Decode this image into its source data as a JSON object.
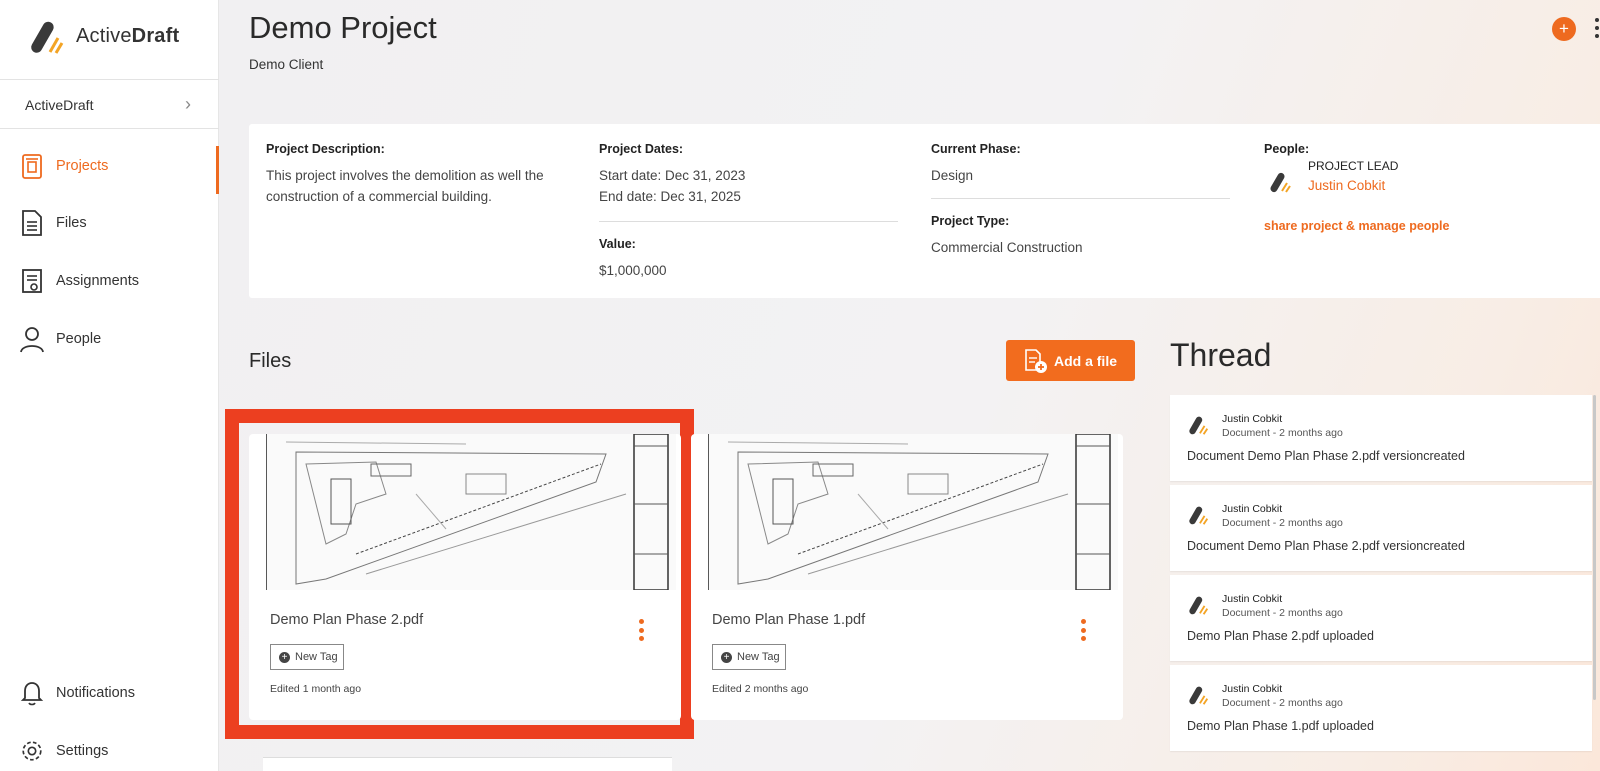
{
  "app": {
    "logo_prefix": "Active",
    "logo_bold": "Draft"
  },
  "sidebar": {
    "org": "ActiveDraft",
    "items": [
      {
        "label": "Projects",
        "icon": "projects-icon",
        "active": true
      },
      {
        "label": "Files",
        "icon": "file-icon"
      },
      {
        "label": "Assignments",
        "icon": "assignment-icon"
      },
      {
        "label": "People",
        "icon": "person-icon"
      }
    ],
    "bottom_items": [
      {
        "label": "Notifications",
        "icon": "bell-icon"
      },
      {
        "label": "Settings",
        "icon": "gear-icon"
      }
    ]
  },
  "header": {
    "title": "Demo Project",
    "client": "Demo Client"
  },
  "project": {
    "description_label": "Project Description:",
    "description_line1": "This project involves the demolition as well the",
    "description_line2": "construction of a commercial building.",
    "dates_label": "Project Dates:",
    "start": "Start date: Dec 31, 2023",
    "end": "End date: Dec 31, 2025",
    "value_label": "Value:",
    "value": "$1,000,000",
    "phase_label": "Current Phase:",
    "phase": "Design",
    "type_label": "Project Type:",
    "type": "Commercial Construction",
    "people_label": "People:",
    "lead_role": "PROJECT LEAD",
    "lead_name": "Justin Cobkit",
    "manage_link": "share project & manage people"
  },
  "files": {
    "title": "Files",
    "add_button": "Add a file",
    "cards": [
      {
        "name": "Demo Plan Phase 2.pdf",
        "tag": "New Tag",
        "edited": "Edited 1 month ago"
      },
      {
        "name": "Demo Plan Phase 1.pdf",
        "tag": "New Tag",
        "edited": "Edited 2 months ago"
      }
    ]
  },
  "thread": {
    "title": "Thread",
    "items": [
      {
        "name": "Justin Cobkit",
        "meta": "Document - 2 months ago",
        "text": "Document Demo Plan Phase 2.pdf versioncreated"
      },
      {
        "name": "Justin Cobkit",
        "meta": "Document - 2 months ago",
        "text": "Document Demo Plan Phase 2.pdf versioncreated"
      },
      {
        "name": "Justin Cobkit",
        "meta": "Document - 2 months ago",
        "text": "Demo Plan Phase 2.pdf uploaded"
      },
      {
        "name": "Justin Cobkit",
        "meta": "Document - 2 months ago",
        "text": "Demo Plan Phase 1.pdf uploaded"
      }
    ]
  },
  "colors": {
    "accent": "#ee6a1f",
    "highlight": "#ec3f20"
  }
}
